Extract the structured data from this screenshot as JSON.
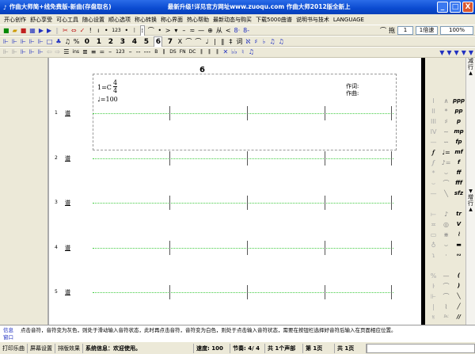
{
  "title": {
    "app": "作曲大师简+线免费版-新曲(存盘取名)",
    "promo": "最新升级!详见官方网址www.zuoqu.com 作曲大师2012版全新上"
  },
  "window_buttons": [
    "_",
    "□",
    "X"
  ],
  "menu": [
    "开心创作",
    "舒心享受",
    "可心工具",
    "随心设置",
    "顺心选项",
    "称心转换",
    "称心界面",
    "热心帮助",
    "最新动态与购买",
    "下载5000曲谱",
    "说明书与技术",
    "LANGUAGE"
  ],
  "toolbar1": {
    "tail": "拖",
    "field1": "1",
    "field2": "1倍速",
    "zoom": "100%"
  },
  "toolbar2": {
    "digits": [
      "0",
      "1",
      "2",
      "3",
      "4",
      "5",
      "6",
      "7"
    ],
    "symbols": [
      "X",
      "⌒",
      "⌒",
      "♩",
      "|",
      "‖",
      "‡",
      "词",
      "ℵ",
      "♯",
      "♭",
      "♫",
      "♫"
    ]
  },
  "toolbar3": {
    "symbols": [
      "B",
      "‖",
      "DS",
      "FN",
      "DC",
      "‖",
      "‖",
      "‖",
      "✕",
      "♭♭",
      "♮",
      "♫"
    ]
  },
  "score": {
    "page_number": "6",
    "key": "1=C",
    "time_top": "4",
    "time_bottom": "4",
    "tempo": "=100",
    "lyricist": "作词:",
    "composer": "作曲:",
    "rows": [
      "1",
      "2",
      "3",
      "4",
      "5"
    ],
    "row_tag": "谱"
  },
  "palette": {
    "tab1": "减行",
    "tab2": "增行"
  },
  "info": {
    "label1": "信息",
    "label2": "窗口",
    "message": "点击音符，音符变为灰色，则处于滑动输入音符状态，此时再点击音符，音符变为白色，则处于点击输入音符状态，需要在按钮栏选择好音符后输入在页面相应位置。"
  },
  "status": {
    "tabs": [
      "打印乐曲",
      "屏幕设置",
      "排版效果"
    ],
    "system": "系统信息：欢迎使用。",
    "speed": "速度: 100",
    "meter": "节奏: 4/ 4",
    "voices": "共 1个声部",
    "page": "第 1页",
    "total": "共 1页"
  }
}
